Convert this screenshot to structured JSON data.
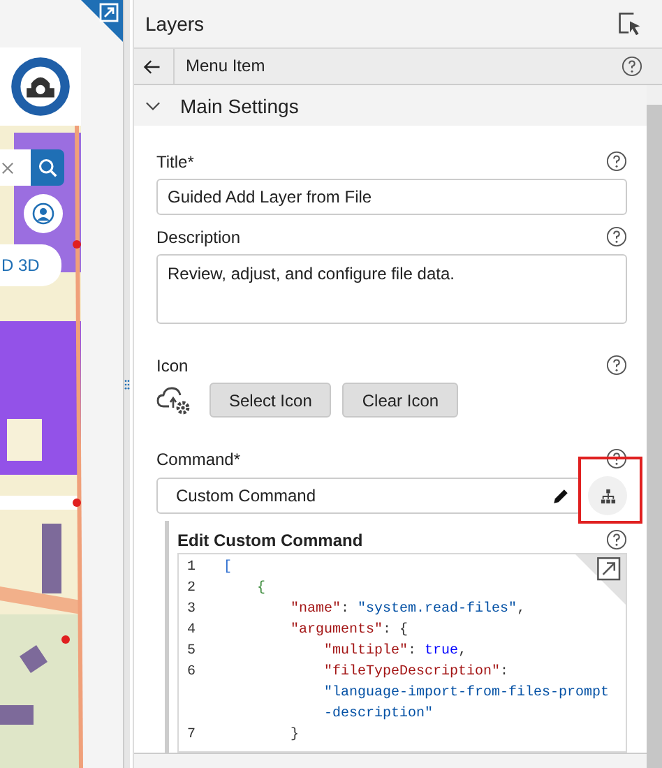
{
  "map": {
    "view_toggle": "D 3D"
  },
  "panel": {
    "title": "Layers"
  },
  "breadcrumb": {
    "title": "Menu Item"
  },
  "section": {
    "title": "Main Settings",
    "expanded": true
  },
  "fields": {
    "title": {
      "label": "Title*",
      "value": "Guided Add Layer from File"
    },
    "description": {
      "label": "Description",
      "value": "Review, adjust, and configure file data."
    },
    "icon": {
      "label": "Icon",
      "buttons": [
        "Select Icon",
        "Clear Icon"
      ]
    },
    "command": {
      "label": "Command*",
      "value": "Custom Command"
    }
  },
  "editor": {
    "label": "Edit Custom Command",
    "lines": [
      {
        "number": "1",
        "segments": [
          {
            "kind": "bracket",
            "text": "["
          }
        ]
      },
      {
        "number": "2",
        "segments": [
          {
            "kind": "brace",
            "text": "    {"
          }
        ]
      },
      {
        "number": "3",
        "segments": [
          {
            "kind": "key",
            "text": "        \"name\""
          },
          {
            "kind": "punct",
            "text": ": "
          },
          {
            "kind": "string",
            "text": "\"system.read-files\""
          },
          {
            "kind": "punct",
            "text": ","
          }
        ]
      },
      {
        "number": "4",
        "segments": [
          {
            "kind": "key",
            "text": "        \"arguments\""
          },
          {
            "kind": "punct",
            "text": ": {"
          }
        ]
      },
      {
        "number": "5",
        "segments": [
          {
            "kind": "key",
            "text": "            \"multiple\""
          },
          {
            "kind": "punct",
            "text": ": "
          },
          {
            "kind": "bool",
            "text": "true"
          },
          {
            "kind": "punct",
            "text": ","
          }
        ]
      },
      {
        "number": "6",
        "segments": [
          {
            "kind": "key",
            "text": "            \"fileTypeDescription\""
          },
          {
            "kind": "punct",
            "text": ":"
          }
        ]
      },
      {
        "segments": [
          {
            "kind": "string",
            "text": "            \"language-import-from-files-prompt"
          }
        ]
      },
      {
        "segments": [
          {
            "kind": "string",
            "text": "            -description\""
          }
        ]
      },
      {
        "number": "7",
        "segments": [
          {
            "kind": "punct",
            "text": "        }"
          }
        ]
      }
    ]
  }
}
